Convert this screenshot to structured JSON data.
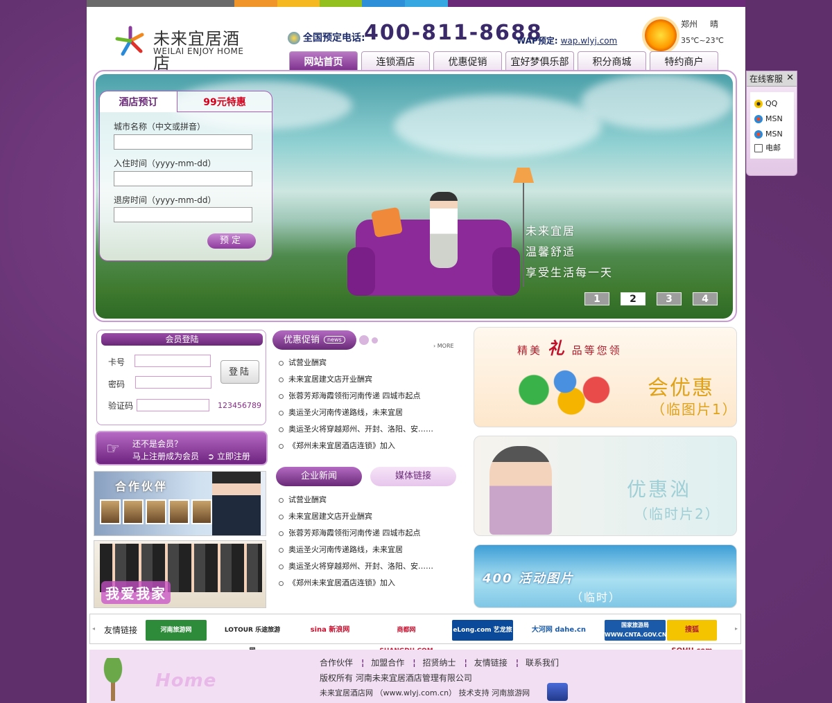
{
  "header": {
    "logo_cn": "未来宜居酒店",
    "logo_en": "WEILAI ENJOY HOME",
    "phone_label": "全国预定电话:",
    "phone_number": "400-811-8688",
    "wap_label": "WAP预定:",
    "wap_url": "wap.wlyj.com",
    "weather_city": "郑州",
    "weather_state": "晴",
    "weather_temp": "35℃~23℃"
  },
  "nav": {
    "items": [
      {
        "label": "网站首页"
      },
      {
        "label": "连锁酒店"
      },
      {
        "label": "优惠促销"
      },
      {
        "label": "宜好梦俱乐部"
      },
      {
        "label": "积分商城"
      },
      {
        "label": "特约商户"
      }
    ],
    "active_index": 0
  },
  "banner": {
    "line1": "未来宜居",
    "line2": "温馨舒适",
    "line3": "享受生活每一天",
    "pages": [
      "1",
      "2",
      "3",
      "4"
    ],
    "current_page": "2"
  },
  "booking": {
    "tab_hotel": "酒店预订",
    "tab_special": "99元特惠",
    "city_label": "城市名称（中文或拼音）",
    "checkin_label": "入住时间（yyyy-mm-dd）",
    "checkout_label": "退房时间（yyyy-mm-dd）",
    "submit": "预定"
  },
  "login": {
    "title": "会员登陆",
    "card_label": "卡号",
    "password_label": "密码",
    "captcha_label": "验证码",
    "captcha_value": "123456789",
    "submit": "登陆"
  },
  "register": {
    "line1": "还不是会员？",
    "line2": "马上注册成为会员",
    "button": "立即注册"
  },
  "partners": {
    "banner1_title": "合作伙伴",
    "banner2_title": "我爱我家"
  },
  "promo_news": {
    "title": "优惠促销",
    "tag": "news",
    "more": "MORE",
    "items": [
      "试营业酬宾",
      "未来宜居建文店开业酬宾",
      "张蓉芳郑海霞领衔河南传递  四城市起点",
      "奥运圣火河南传递路线，未来宜居",
      "奥运圣火将穿越郑州、开封、洛阳、安……",
      "《郑州未来宜居酒店连锁》加入"
    ]
  },
  "company_news": {
    "tab_active": "企业新闻",
    "tab_other": "媒体链接",
    "items": [
      "试营业酬宾",
      "未来宜居建文店开业酬宾",
      "张蓉芳郑海霞领衔河南传递  四城市起点",
      "奥运圣火河南传递路线，未来宜居",
      "奥运圣火将穿越郑州、开封、洛阳、安……",
      "《郑州未来宜居酒店连锁》加入"
    ]
  },
  "promos": {
    "p1_head": "精美",
    "p1_gift": "礼",
    "p1_tail": "品等您领",
    "p1_main": "会优惠",
    "p1_sub": "（临图片1）",
    "p2_main": "优惠汹",
    "p2_sub": "（临时片2）",
    "p3_main": "400 活动图片",
    "p3_sub": "（临时）"
  },
  "links": {
    "label": "友情链接",
    "items": [
      {
        "text": "河南旅游网 uhenan.com",
        "color": "#2e8b3a"
      },
      {
        "text": "LOTOUR 乐途旅游网",
        "color": "#222222"
      },
      {
        "text": "sina 新浪网",
        "color": "#c8102e"
      },
      {
        "text": "商都网 SHANGDU.COM",
        "color": "#c8102e"
      },
      {
        "text": "eLong.com 艺龙旅行网",
        "color": "#0b4a9a"
      },
      {
        "text": "大河网 dahe.cn",
        "color": "#1a5aa8"
      },
      {
        "text": "国家旅游局 WWW.CNTA.GOV.CN",
        "color": "#1a5aa8"
      },
      {
        "text": "搜狐 SOHU.com",
        "color": "#e8b600"
      }
    ]
  },
  "footer": {
    "menu": [
      "合作伙伴",
      "加盟合作",
      "招贤纳士",
      "友情链接",
      "联系我们"
    ],
    "copyright": "版权所有  河南未来宜居酒店管理有限公司",
    "site": "未来宜居酒店网 （www.wlyj.com.cn）  技术支持  河南旅游网",
    "home_text": "Home"
  },
  "online_service": {
    "title": "在线客服",
    "items": [
      {
        "label": "QQ",
        "icon": "qq-icon"
      },
      {
        "label": "MSN",
        "icon": "msn-icon"
      },
      {
        "label": "MSN",
        "icon": "msn-icon"
      },
      {
        "label": "电邮",
        "icon": "mail-icon"
      }
    ]
  },
  "colors": {
    "brand_purple": "#6a2a78",
    "accent_red": "#d4001c",
    "page_bg": "#5e2f6a"
  }
}
